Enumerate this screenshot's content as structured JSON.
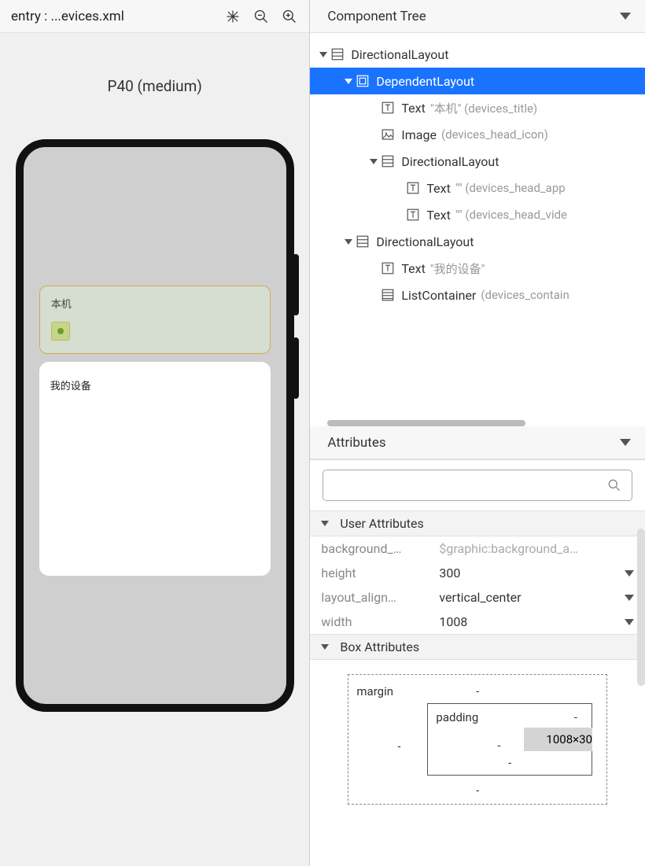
{
  "left": {
    "header_title": "entry : ...evices.xml",
    "device_label": "P40 (medium)"
  },
  "preview": {
    "card1_title": "本机",
    "card2_title": "我的设备"
  },
  "panels": {
    "component_tree": "Component Tree",
    "attributes": "Attributes"
  },
  "tree": [
    {
      "level": 0,
      "exp": true,
      "icon": "directional",
      "name": "DirectionalLayout",
      "meta": "",
      "sel": false
    },
    {
      "level": 1,
      "exp": true,
      "icon": "dependent",
      "name": "DependentLayout",
      "meta": "",
      "sel": true
    },
    {
      "level": 2,
      "exp": false,
      "icon": "text",
      "name": "Text",
      "meta": "\"本机\" (devices_title)",
      "sel": false
    },
    {
      "level": 2,
      "exp": false,
      "icon": "image",
      "name": "Image",
      "meta": "(devices_head_icon)",
      "sel": false
    },
    {
      "level": 2,
      "exp": true,
      "icon": "directional",
      "name": "DirectionalLayout",
      "meta": "",
      "sel": false
    },
    {
      "level": 3,
      "exp": false,
      "icon": "text",
      "name": "Text",
      "meta": "\"\" (devices_head_app",
      "sel": false
    },
    {
      "level": 3,
      "exp": false,
      "icon": "text",
      "name": "Text",
      "meta": "\"\" (devices_head_vide",
      "sel": false
    },
    {
      "level": 1,
      "exp": true,
      "icon": "directional",
      "name": "DirectionalLayout",
      "meta": "",
      "sel": false
    },
    {
      "level": 2,
      "exp": false,
      "icon": "text",
      "name": "Text",
      "meta": "\"我的设备\"",
      "sel": false
    },
    {
      "level": 2,
      "exp": false,
      "icon": "list",
      "name": "ListContainer",
      "meta": "(devices_contain",
      "sel": false
    }
  ],
  "attr_sections": {
    "user": "User Attributes",
    "box": "Box Attributes"
  },
  "user_attrs": [
    {
      "k": "background_…",
      "v": "$graphic:background_a…",
      "hint": true,
      "dd": false
    },
    {
      "k": "height",
      "v": "300",
      "hint": false,
      "dd": true
    },
    {
      "k": "layout_align…",
      "v": "vertical_center",
      "hint": false,
      "dd": true
    },
    {
      "k": "width",
      "v": "1008",
      "hint": false,
      "dd": true
    }
  ],
  "box": {
    "margin_label": "margin",
    "padding_label": "padding",
    "dash": "-",
    "content": "1008×30"
  },
  "search_placeholder": ""
}
